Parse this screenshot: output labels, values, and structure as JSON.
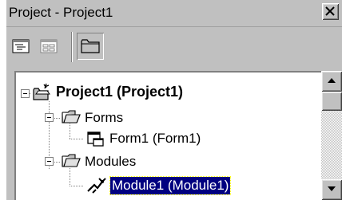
{
  "window": {
    "title": "Project - Project1"
  },
  "toolbar": {
    "buttons": [
      {
        "name": "view-code-button",
        "icon": "view-code-icon"
      },
      {
        "name": "view-object-button",
        "icon": "view-object-icon"
      },
      {
        "name": "toggle-folders-button",
        "icon": "folder-icon",
        "pressed": true
      }
    ]
  },
  "tree": {
    "root": {
      "label": "Project1 (Project1)",
      "icon": "project-icon",
      "expanded": true
    },
    "folders": [
      {
        "label": "Forms",
        "icon": "folder-open-icon",
        "expanded": true,
        "items": [
          {
            "label": "Form1 (Form1)",
            "icon": "form-icon",
            "selected": false
          }
        ]
      },
      {
        "label": "Modules",
        "icon": "folder-open-icon",
        "expanded": true,
        "items": [
          {
            "label": "Module1 (Module1)",
            "icon": "module-icon",
            "selected": true
          }
        ]
      }
    ]
  },
  "colors": {
    "chrome": "#c0c0c0",
    "selection": "#000080",
    "folder": "#c0c0c0"
  }
}
